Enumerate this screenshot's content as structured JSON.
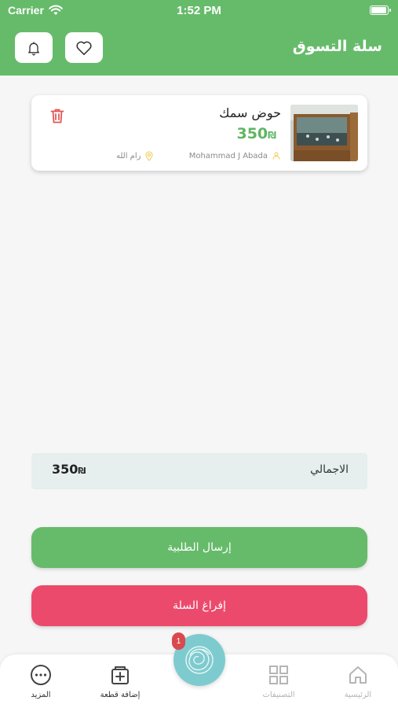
{
  "status_bar": {
    "carrier": "Carrier",
    "time": "1:52 PM"
  },
  "header": {
    "title": "سلة التسوق"
  },
  "cart": {
    "items": [
      {
        "name": "حوض سمك",
        "price": "350",
        "currency": "₪",
        "seller": "Mohammad J Abada",
        "location": "رام الله"
      }
    ]
  },
  "summary": {
    "total_label": "الاجمالي",
    "total_amount": "350",
    "currency": "₪"
  },
  "actions": {
    "send_order": "إرسال الطلبية",
    "empty_cart": "إفراغ السلة"
  },
  "tabbar": {
    "home": "الرئيسية",
    "categories": "التصنيفات",
    "cart_badge": "1",
    "add_item": "إضافة قطعة",
    "more": "المزيد"
  },
  "colors": {
    "primary": "#66bb6a",
    "danger": "#ec4a6c",
    "price": "#5fb563"
  }
}
